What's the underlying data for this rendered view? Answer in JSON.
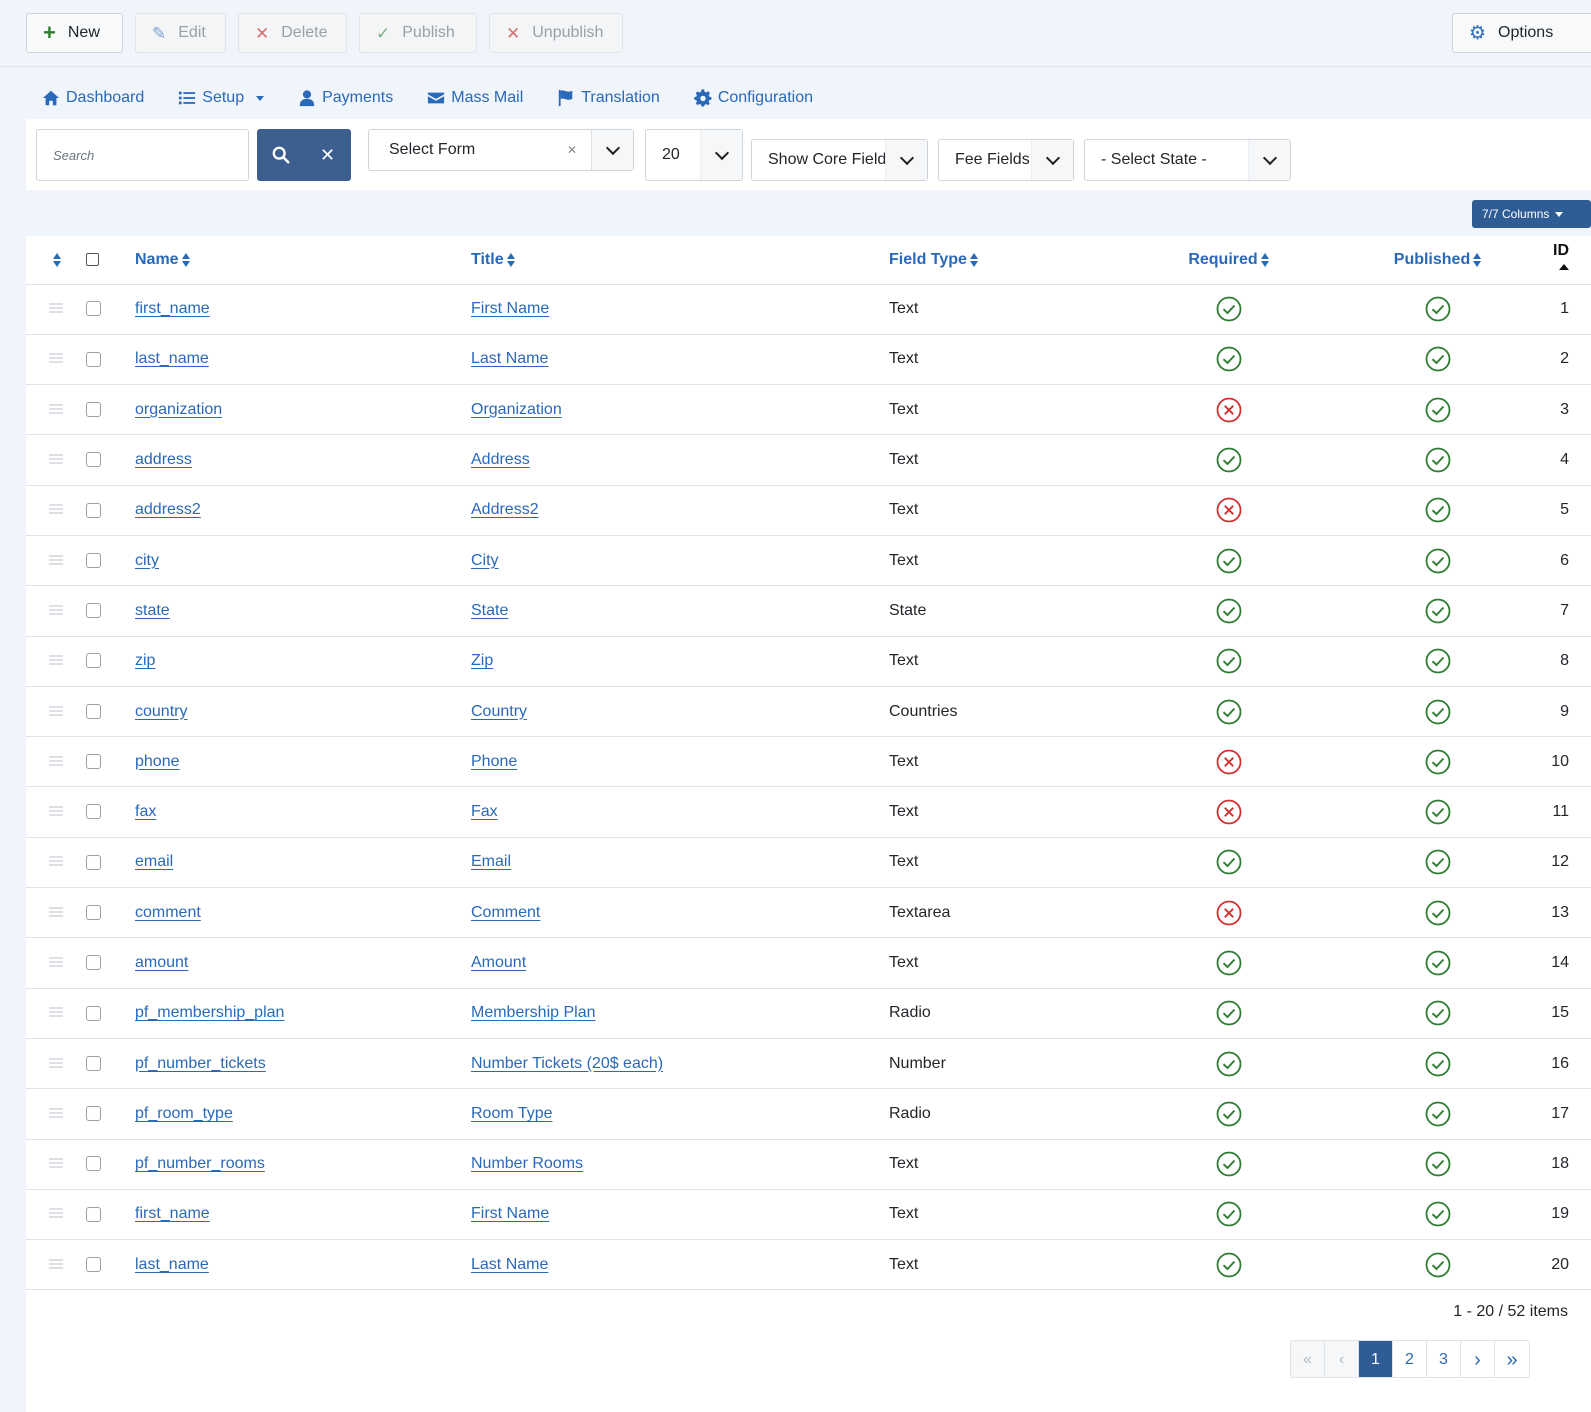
{
  "toolbar": {
    "new": "New",
    "edit": "Edit",
    "delete": "Delete",
    "publish": "Publish",
    "unpublish": "Unpublish",
    "options": "Options"
  },
  "nav": {
    "dashboard": "Dashboard",
    "setup": "Setup",
    "payments": "Payments",
    "massmail": "Mass Mail",
    "translation": "Translation",
    "configuration": "Configuration"
  },
  "filters": {
    "search_placeholder": "Search",
    "form": "Select Form",
    "limit": "20",
    "core": "Show Core Field",
    "fee": "Fee Fields",
    "state": "- Select State -"
  },
  "columns_label": "7/7 Columns",
  "table": {
    "headers": {
      "name": "Name",
      "title": "Title",
      "type": "Field Type",
      "required": "Required",
      "published": "Published",
      "id": "ID"
    },
    "rows": [
      {
        "name": "first_name",
        "title": "First Name",
        "type": "Text",
        "required": true,
        "published": true,
        "id": "1"
      },
      {
        "name": "last_name",
        "title": "Last Name",
        "type": "Text",
        "required": true,
        "published": true,
        "id": "2"
      },
      {
        "name": "organization",
        "title": "Organization",
        "type": "Text",
        "required": false,
        "published": true,
        "id": "3"
      },
      {
        "name": "address",
        "title": "Address",
        "type": "Text",
        "required": true,
        "published": true,
        "id": "4"
      },
      {
        "name": "address2",
        "title": "Address2",
        "type": "Text",
        "required": false,
        "published": true,
        "id": "5"
      },
      {
        "name": "city",
        "title": "City",
        "type": "Text",
        "required": true,
        "published": true,
        "id": "6"
      },
      {
        "name": "state",
        "title": "State",
        "type": "State",
        "required": true,
        "published": true,
        "id": "7"
      },
      {
        "name": "zip",
        "title": "Zip",
        "type": "Text",
        "required": true,
        "published": true,
        "id": "8"
      },
      {
        "name": "country",
        "title": "Country",
        "type": "Countries",
        "required": true,
        "published": true,
        "id": "9"
      },
      {
        "name": "phone",
        "title": "Phone",
        "type": "Text",
        "required": false,
        "published": true,
        "id": "10"
      },
      {
        "name": "fax",
        "title": "Fax",
        "type": "Text",
        "required": false,
        "published": true,
        "id": "11"
      },
      {
        "name": "email",
        "title": "Email",
        "type": "Text",
        "required": true,
        "published": true,
        "id": "12"
      },
      {
        "name": "comment",
        "title": "Comment",
        "type": "Textarea",
        "required": false,
        "published": true,
        "id": "13"
      },
      {
        "name": "amount",
        "title": "Amount",
        "type": "Text",
        "required": true,
        "published": true,
        "id": "14"
      },
      {
        "name": "pf_membership_plan",
        "title": "Membership Plan",
        "type": "Radio",
        "required": true,
        "published": true,
        "id": "15"
      },
      {
        "name": "pf_number_tickets",
        "title": "Number Tickets (20$ each)",
        "type": "Number",
        "required": true,
        "published": true,
        "id": "16"
      },
      {
        "name": "pf_room_type",
        "title": "Room Type",
        "type": "Radio",
        "required": true,
        "published": true,
        "id": "17"
      },
      {
        "name": "pf_number_rooms",
        "title": "Number Rooms",
        "type": "Text",
        "required": true,
        "published": true,
        "id": "18"
      },
      {
        "name": "first_name",
        "title": "First Name",
        "type": "Text",
        "required": true,
        "published": true,
        "id": "19"
      },
      {
        "name": "last_name",
        "title": "Last Name",
        "type": "Text",
        "required": true,
        "published": true,
        "id": "20"
      }
    ]
  },
  "pagination": {
    "summary": "1 - 20 / 52 items",
    "pages": [
      "1",
      "2",
      "3"
    ],
    "current": "1"
  },
  "colors": {
    "accent": "#2a69b8",
    "ok": "#2f7d32",
    "bad": "#d32f2f",
    "primary_btn": "#2f5c95"
  }
}
